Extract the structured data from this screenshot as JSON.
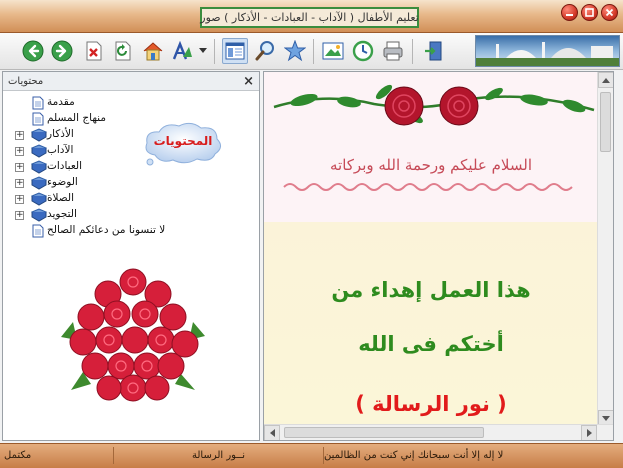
{
  "window": {
    "title": "تعليم الأطفال ( الآداب - العبادات - الأذكار ) صور",
    "controls": [
      "minimize",
      "maximize",
      "close"
    ]
  },
  "toolbar": {
    "buttons": [
      {
        "name": "back-button",
        "icon": "arrow-left-icon"
      },
      {
        "name": "forward-button",
        "icon": "arrow-right-icon"
      },
      {
        "name": "stop-button",
        "icon": "stop-icon"
      },
      {
        "name": "refresh-button",
        "icon": "refresh-icon"
      },
      {
        "name": "home-button",
        "icon": "home-icon"
      },
      {
        "name": "font-button",
        "icon": "font-icon"
      },
      {
        "name": "font-dropdown-button",
        "icon": "caret-down-icon"
      },
      {
        "name": "toggle-contents-button",
        "icon": "panel-icon"
      },
      {
        "name": "search-button",
        "icon": "magnifier-icon"
      },
      {
        "name": "favorites-button",
        "icon": "star-icon"
      },
      {
        "name": "slideshow-button",
        "icon": "image-icon"
      },
      {
        "name": "history-button",
        "icon": "clock-icon"
      },
      {
        "name": "print-button",
        "icon": "printer-icon"
      },
      {
        "name": "exit-button",
        "icon": "exit-door-icon"
      }
    ]
  },
  "sidebar": {
    "title": "محتويات",
    "close_glyph": "×",
    "tree": [
      {
        "label": "مقدمة",
        "expandable": false,
        "icon": "page-icon"
      },
      {
        "label": "منهاج المسلم",
        "expandable": false,
        "icon": "page-icon"
      },
      {
        "label": "الأذكار",
        "expandable": true,
        "icon": "book-icon"
      },
      {
        "label": "الآداب",
        "expandable": true,
        "icon": "book-icon"
      },
      {
        "label": "العبادات",
        "expandable": true,
        "icon": "book-icon"
      },
      {
        "label": "الوضوء",
        "expandable": true,
        "icon": "book-icon"
      },
      {
        "label": "الصلاة",
        "expandable": true,
        "icon": "book-icon"
      },
      {
        "label": "التجويد",
        "expandable": true,
        "icon": "book-icon"
      },
      {
        "label": "لا تنسونا من دعائكم الصالح",
        "expandable": false,
        "icon": "page-icon"
      }
    ],
    "bubble_text": "المحتويات",
    "expand_glyph": "+"
  },
  "content": {
    "greeting": "السلام عليكم ورحمة الله وبركاته",
    "dedication_lines": [
      "هذا العمل إهداء من",
      "أختكم فى الله",
      "( نور الرسالة )"
    ]
  },
  "statusbar": {
    "cells": [
      "لا إله إلا أنت سبحانك إني كنت من الظالمين",
      "نــور الرسالة",
      "مكتمل"
    ]
  },
  "colors": {
    "titlebar": "#e7b88a",
    "title_frame_border": "#3a8d3e",
    "greeting_text": "#c64a57",
    "dedication_green": "#2e8b1e",
    "dedication_red": "#e11b1b",
    "bubble_text": "#d81c1c",
    "statusbar": "#d5935f"
  }
}
